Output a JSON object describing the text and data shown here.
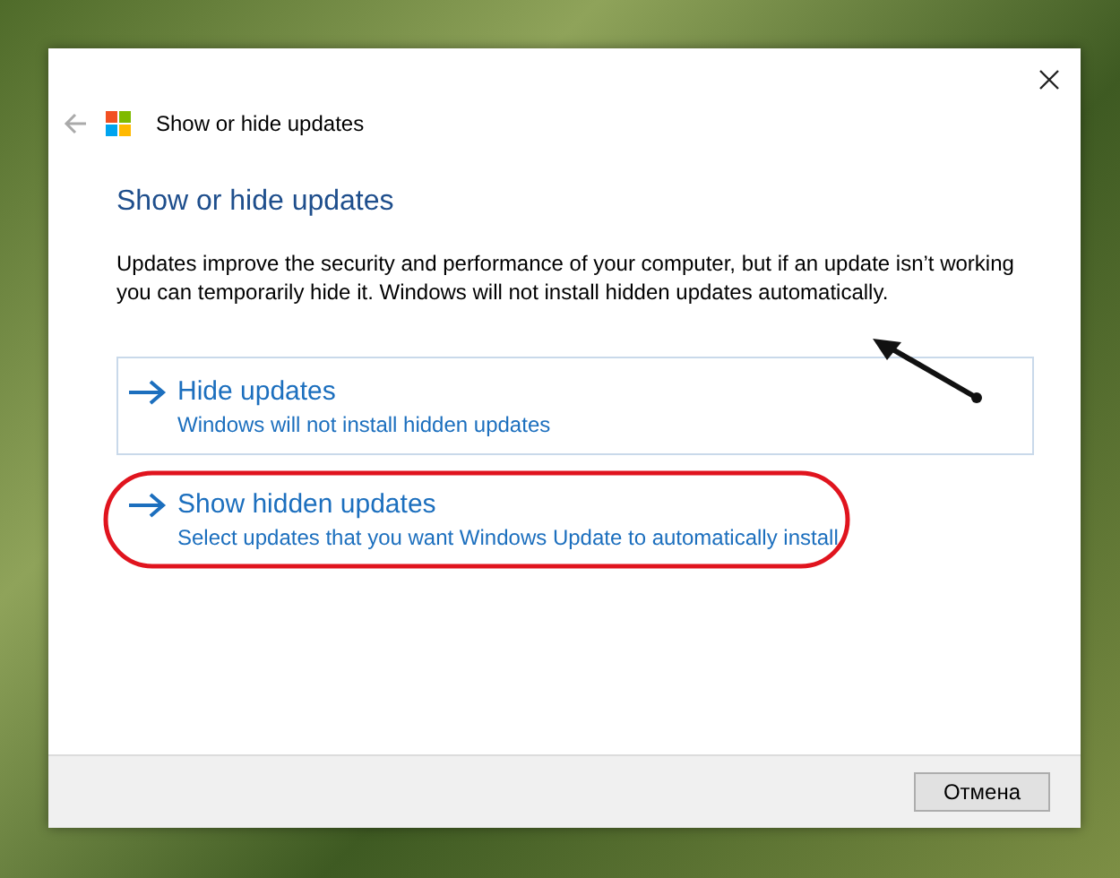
{
  "window": {
    "title": "Show or hide updates"
  },
  "heading": "Show or hide updates",
  "description": "Updates improve the security and performance of your computer, but if an update isn’t working you can temporarily hide it. Windows will not install hidden updates automatically.",
  "options": [
    {
      "title": "Hide updates",
      "subtitle": "Windows will not install hidden updates",
      "focused": true,
      "highlighted": false
    },
    {
      "title": "Show hidden updates",
      "subtitle": "Select updates that you want Windows Update to automatically install",
      "focused": false,
      "highlighted": true
    }
  ],
  "buttons": [
    "Отмена"
  ]
}
